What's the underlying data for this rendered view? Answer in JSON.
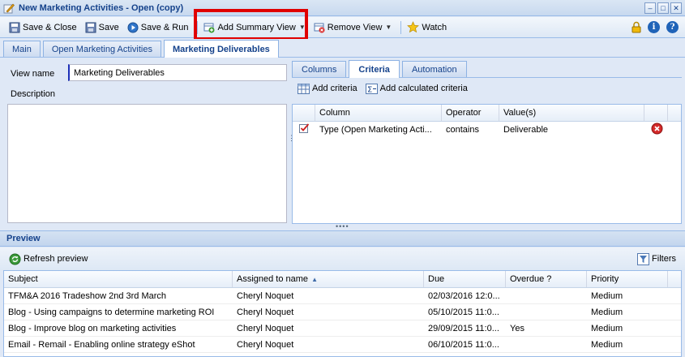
{
  "window": {
    "title": "New Marketing Activities - Open (copy)"
  },
  "toolbar": {
    "save_close": "Save & Close",
    "save": "Save",
    "save_run": "Save & Run",
    "add_summary_view": "Add Summary View",
    "remove_view": "Remove View",
    "watch": "Watch"
  },
  "tabs": [
    "Main",
    "Open Marketing Activities",
    "Marketing Deliverables"
  ],
  "form": {
    "view_name_label": "View name",
    "view_name_value": "Marketing Deliverables",
    "description_label": "Description",
    "description_value": ""
  },
  "right_tabs": [
    "Columns",
    "Criteria",
    "Automation"
  ],
  "criteria": {
    "add_criteria": "Add criteria",
    "add_calculated": "Add calculated criteria",
    "headers": [
      "Column",
      "Operator",
      "Value(s)"
    ],
    "rows": [
      {
        "column": "Type (Open Marketing Acti...",
        "operator": "contains",
        "value": "Deliverable"
      }
    ]
  },
  "preview": {
    "title": "Preview",
    "refresh": "Refresh preview",
    "filters": "Filters",
    "headers": [
      "Subject",
      "Assigned to name",
      "Due",
      "Overdue ?",
      "Priority"
    ],
    "sorted_column": "Assigned to name",
    "rows": [
      {
        "subject": "TFM&A 2016 Tradeshow 2nd 3rd March",
        "assigned": "Cheryl Noquet",
        "due": "02/03/2016 12:0...",
        "overdue": "",
        "priority": "Medium"
      },
      {
        "subject": "Blog - Using campaigns to determine marketing ROI",
        "assigned": "Cheryl Noquet",
        "due": "05/10/2015 11:0...",
        "overdue": "",
        "priority": "Medium"
      },
      {
        "subject": "Blog - Improve blog on marketing activities",
        "assigned": "Cheryl Noquet",
        "due": "29/09/2015 11:0...",
        "overdue": "Yes",
        "priority": "Medium"
      },
      {
        "subject": "Email - Remail - Enabling online strategy eShot",
        "assigned": "Cheryl Noquet",
        "due": "06/10/2015 11:0...",
        "overdue": "",
        "priority": "Medium"
      }
    ]
  },
  "colors": {
    "accent": "#15428b",
    "panel_bg": "#dfe8f6",
    "highlight_border": "#e00000"
  }
}
